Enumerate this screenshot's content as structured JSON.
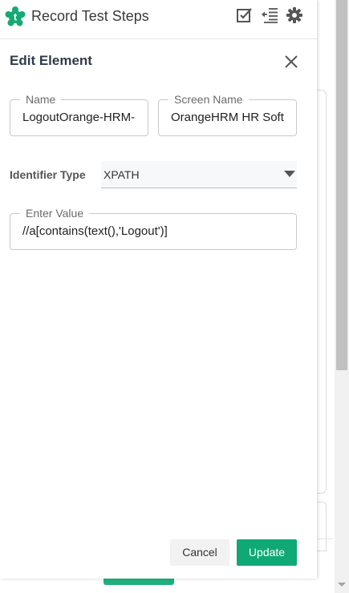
{
  "app": {
    "title": "Record Test Steps",
    "logo_icon": "testsigma-logo-icon",
    "brand_color": "#16a974"
  },
  "header_icons": [
    {
      "name": "edit-checkbox-icon"
    },
    {
      "name": "collapse-list-icon"
    },
    {
      "name": "settings-gear-icon"
    }
  ],
  "edit_element": {
    "title": "Edit Element",
    "close_icon": "close-icon",
    "name_field": {
      "label": "Name",
      "value": "LogoutOrange-HRM-"
    },
    "screen_name_field": {
      "label": "Screen Name",
      "value": "OrangeHRM HR Soft"
    },
    "identifier_type": {
      "label": "Identifier Type",
      "selected": "XPATH"
    },
    "value_field": {
      "label": "Enter Value",
      "value": "//a[contains(text(),'Logout')]"
    }
  },
  "actions": {
    "cancel_label": "Cancel",
    "update_label": "Update",
    "update_color": "#0fa976"
  }
}
